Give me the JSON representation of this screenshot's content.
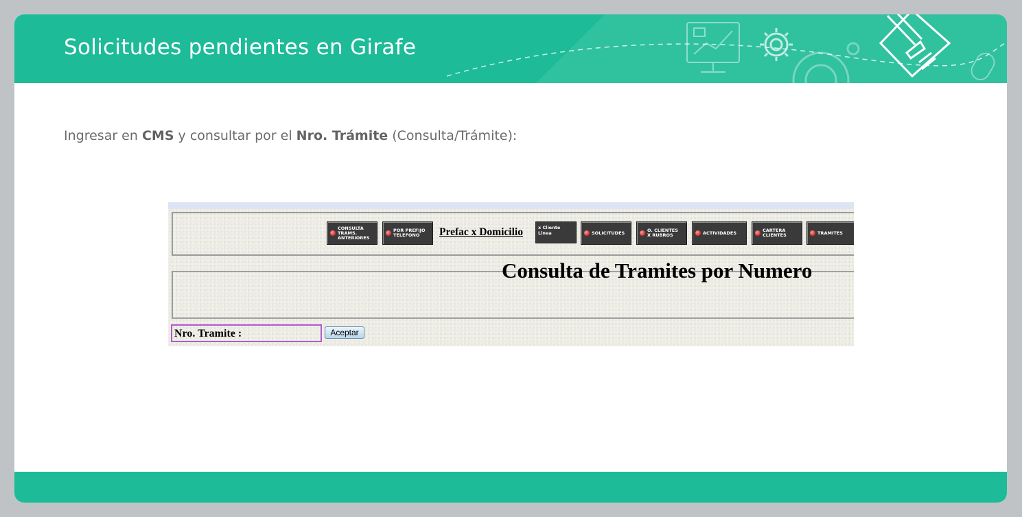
{
  "slide": {
    "title": "Solicitudes pendientes en Girafe",
    "instruction": {
      "t1": "Ingresar en ",
      "b1": "CMS",
      "t2": " y consultar por el ",
      "b2": "Nro. Trámite",
      "t3": " (Consulta/Trámite):"
    }
  },
  "colors": {
    "header": "#1dbb98",
    "footer": "#1dbb98",
    "background": "#bfc3c6"
  },
  "header_icons": [
    "monitor-chart-icon",
    "gear-icon",
    "gears-icon",
    "pencil-document-icon",
    "mouse-icon"
  ],
  "screenshot": {
    "nav": {
      "consulta_trams": "Consulta\nTrams.\nAnteriores",
      "por_prefijo": "Por prefijo\nTelefono",
      "prefac_link": "Prefac x Domicilio",
      "x_cliente": "x Cliente\nLinea",
      "solicitudes": "Solicitudes",
      "o_clientes": "O. Clientes\nx Rubros",
      "actividades": "Actividades",
      "cartera": "Cartera\nClientes",
      "tramites": "Tramites"
    },
    "form_title": "Consulta de Tramites por Numero",
    "field_label": "Nro. Tramite :",
    "field_value": "",
    "accept_button": "Aceptar"
  }
}
